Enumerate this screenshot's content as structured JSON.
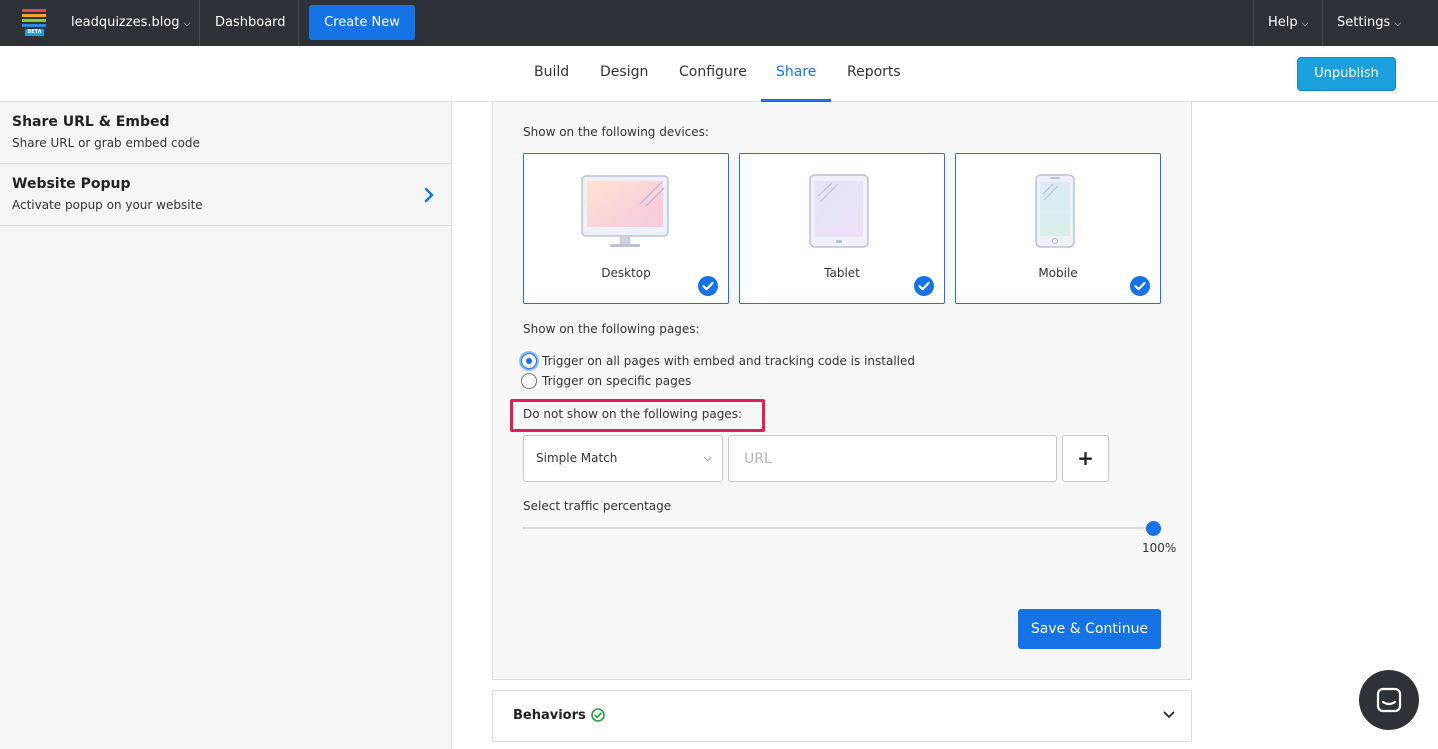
{
  "topbar": {
    "site_name": "leadquizzes.blog",
    "beta_label": "BETA",
    "dashboard": "Dashboard",
    "create_new": "Create New",
    "help": "Help",
    "settings": "Settings"
  },
  "tabs": [
    {
      "label": "Build"
    },
    {
      "label": "Design"
    },
    {
      "label": "Configure"
    },
    {
      "label": "Share",
      "active": true
    },
    {
      "label": "Reports"
    }
  ],
  "unpublish": "Unpublish",
  "sidebar": {
    "items": [
      {
        "title": "Share URL & Embed",
        "subtitle": "Share URL or grab embed code"
      },
      {
        "title": "Website Popup",
        "subtitle": "Activate popup on your website"
      }
    ]
  },
  "main": {
    "devices_label": "Show on the following devices:",
    "devices": [
      {
        "label": "Desktop",
        "checked": true
      },
      {
        "label": "Tablet",
        "checked": true
      },
      {
        "label": "Mobile",
        "checked": true
      }
    ],
    "pages_label": "Show on the following pages:",
    "page_options": [
      {
        "label": "Trigger on all pages with embed and tracking code is installed",
        "selected": true
      },
      {
        "label": "Trigger on specific pages",
        "selected": false
      }
    ],
    "exclude_label": "Do not show on the following pages:",
    "match_select": "Simple Match",
    "url_placeholder": "URL",
    "traffic_label": "Select traffic percentage",
    "traffic_value": "100%",
    "save_continue": "Save & Continue"
  },
  "behaviors": {
    "title": "Behaviors"
  },
  "colors": {
    "accent": "#1573e6",
    "highlight": "#e01f5a",
    "topbar": "#2c3237"
  }
}
